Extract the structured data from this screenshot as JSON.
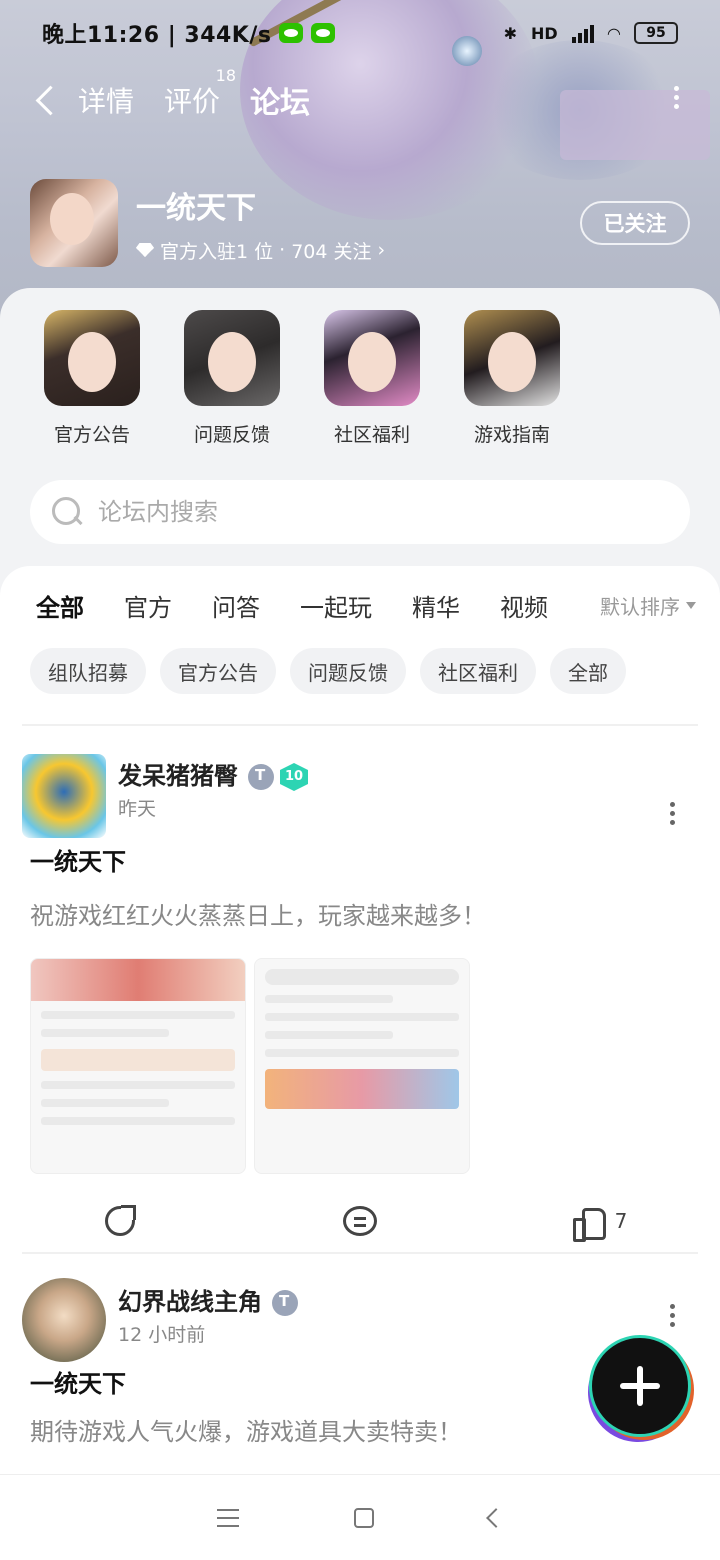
{
  "status_bar": {
    "time": "晚上11:26 | 344K/s",
    "battery": "95",
    "network": "HD"
  },
  "top_nav": {
    "tabs": [
      {
        "label": "详情"
      },
      {
        "label": "评价",
        "badge": "18"
      },
      {
        "label": "论坛"
      }
    ]
  },
  "game": {
    "name": "一统天下",
    "official": "官方入驻1 位",
    "dot": "·",
    "followers": "704 关注",
    "follow_button": "已关注"
  },
  "categories": [
    {
      "label": "官方公告"
    },
    {
      "label": "问题反馈"
    },
    {
      "label": "社区福利"
    },
    {
      "label": "游戏指南"
    }
  ],
  "search": {
    "placeholder": "论坛内搜索"
  },
  "filter_tabs": [
    "全部",
    "官方",
    "问答",
    "一起玩",
    "精华",
    "视频"
  ],
  "sort_label": "默认排序",
  "chips": [
    "组队招募",
    "官方公告",
    "问题反馈",
    "社区福利",
    "全部"
  ],
  "posts": [
    {
      "author": "发呆猪猪臀",
      "level": "10",
      "time": "昨天",
      "title": "一统天下",
      "body": "祝游戏红红火火蒸蒸日上，玩家越来越多！",
      "likes": "7"
    },
    {
      "author": "幻界战线主角",
      "time": "12 小时前",
      "title": "一统天下",
      "body": "期待游戏人气火爆，游戏道具大卖特卖！"
    }
  ],
  "accent_color": "#19d8b5"
}
